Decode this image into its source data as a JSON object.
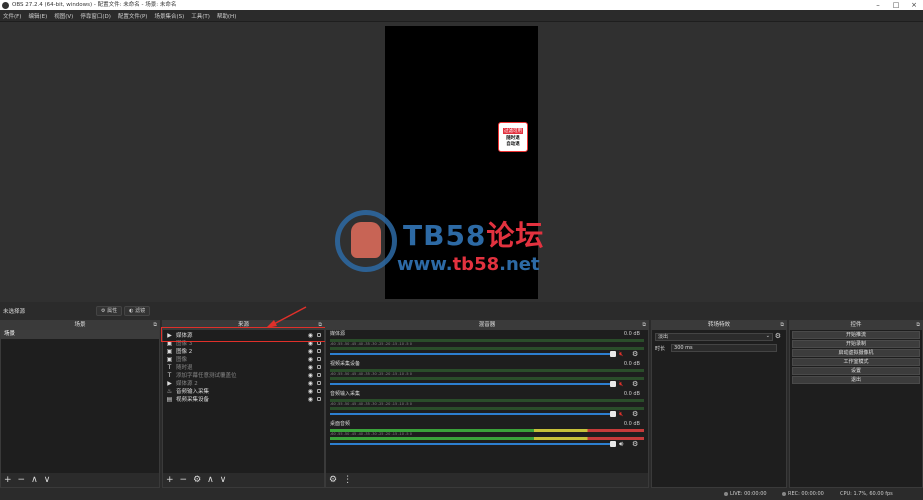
{
  "window": {
    "title": "OBS 27.2.4 (64-bit, windows) - 配置文件: 未命名 - 场景: 未命名"
  },
  "menu": [
    "文件(F)",
    "编辑(E)",
    "视图(V)",
    "停靠窗口(D)",
    "配置文件(P)",
    "场景集合(S)",
    "工具(T)",
    "帮助(H)"
  ],
  "preview": {
    "badge_line1": "过滤可用",
    "badge_line2": "随时退",
    "badge_line3": "自动退"
  },
  "watermark": {
    "title_a": "TB58",
    "title_b": "论坛",
    "url_a": "www.",
    "url_b": "tb58",
    "url_c": ".net"
  },
  "scenebar": {
    "label": "未选择源",
    "properties": "属性",
    "filters": "滤镜"
  },
  "scenes": {
    "header": "场景",
    "items": [
      "场景"
    ]
  },
  "sources": {
    "header": "来源",
    "items": [
      {
        "name": "媒体源",
        "icon": "play-icon",
        "dim": false
      },
      {
        "name": "图像 3",
        "icon": "image-icon",
        "dim": true
      },
      {
        "name": "图像 2",
        "icon": "image-icon",
        "dim": false
      },
      {
        "name": "图像",
        "icon": "image-icon",
        "dim": true
      },
      {
        "name": "随时退",
        "icon": "text-icon",
        "dim": true
      },
      {
        "name": "添加字幕任意测试覆盖位",
        "icon": "text-icon",
        "dim": true
      },
      {
        "name": "媒体源 2",
        "icon": "play-icon",
        "dim": true
      },
      {
        "name": "音频输入采集",
        "icon": "mic-icon",
        "dim": false
      },
      {
        "name": "视频采集设备",
        "icon": "camera-icon",
        "dim": false
      }
    ]
  },
  "mixer": {
    "header": "混音器",
    "ticks": "-60  -55  -50  -45  -40  -35  -30  -25  -20  -15  -10  -5  0",
    "channels": [
      {
        "name": "媒体源",
        "db": "0.0 dB",
        "level": 0,
        "muted": true
      },
      {
        "name": "视频采集设备",
        "db": "0.0 dB",
        "level": 0,
        "muted": true
      },
      {
        "name": "音频输入采集",
        "db": "0.0 dB",
        "level": 0,
        "muted": true
      },
      {
        "name": "桌面音频",
        "db": "0.0 dB",
        "level": 1,
        "muted": false
      }
    ]
  },
  "transitions": {
    "header": "转场特效",
    "selected": "淡出",
    "duration_label": "时长",
    "duration_value": "300 ms"
  },
  "controls": {
    "header": "控件",
    "buttons": [
      "开始推流",
      "开始录制",
      "启动虚拟摄像机",
      "工作室模式",
      "设置",
      "退出"
    ]
  },
  "status": {
    "live": "LIVE: 00:00:00",
    "rec": "REC: 00:00:00",
    "cpu": "CPU: 1.7%, 60.00 fps"
  },
  "colors": {
    "accent": "#2d7fd0",
    "mute": "#e0302a",
    "highlight": "#e0302a"
  }
}
